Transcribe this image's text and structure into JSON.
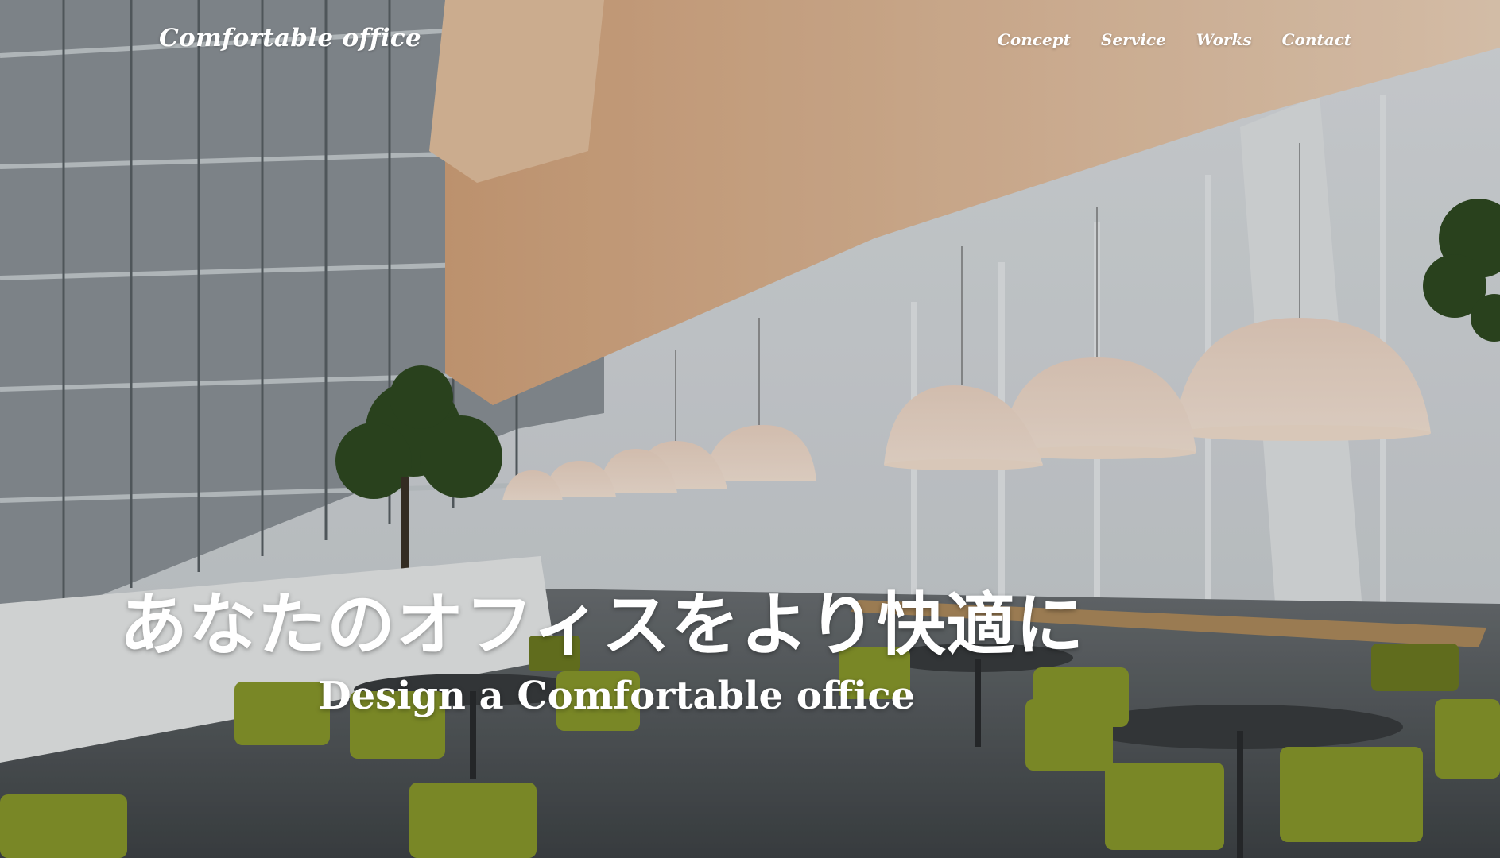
{
  "header": {
    "logo": "Comfortable office",
    "nav": [
      "Concept",
      "Service",
      "Works",
      "Contact"
    ]
  },
  "hero": {
    "headline": "あなたのオフィスをより快適に",
    "subline": "Design a Comfortable office"
  },
  "colors": {
    "text": "#ffffff",
    "chair_green": "#8a9a2c",
    "lamp_glow": "#f3d9c4"
  }
}
